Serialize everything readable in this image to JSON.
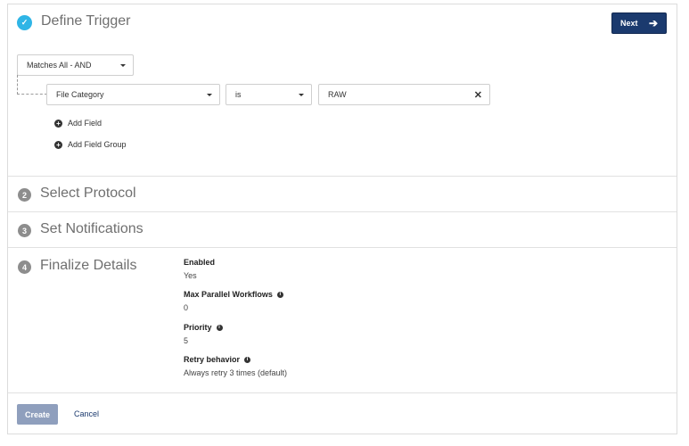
{
  "steps": [
    {
      "number": "✓",
      "title": "Define Trigger"
    },
    {
      "number": "2",
      "title": "Select Protocol"
    },
    {
      "number": "3",
      "title": "Set Notifications"
    },
    {
      "number": "4",
      "title": "Finalize Details"
    }
  ],
  "header": {
    "next_label": "Next",
    "next_icon": "arrow-right-icon"
  },
  "trigger": {
    "match_mode": "Matches All - AND",
    "field": "File Category",
    "operator": "is",
    "value": "RAW",
    "add_field_label": "Add Field",
    "add_field_group_label": "Add Field Group"
  },
  "details": {
    "enabled_label": "Enabled",
    "enabled_value": "Yes",
    "max_parallel_label": "Max Parallel Workflows",
    "max_parallel_value": "0",
    "priority_label": "Priority",
    "priority_value": "5",
    "retry_label": "Retry behavior",
    "retry_value": "Always retry 3 times (default)"
  },
  "footer": {
    "create_label": "Create",
    "cancel_label": "Cancel"
  },
  "colors": {
    "primary": "#1b3a6e",
    "done_badge": "#2fb5e6",
    "disabled_button": "#8f9fbd"
  }
}
